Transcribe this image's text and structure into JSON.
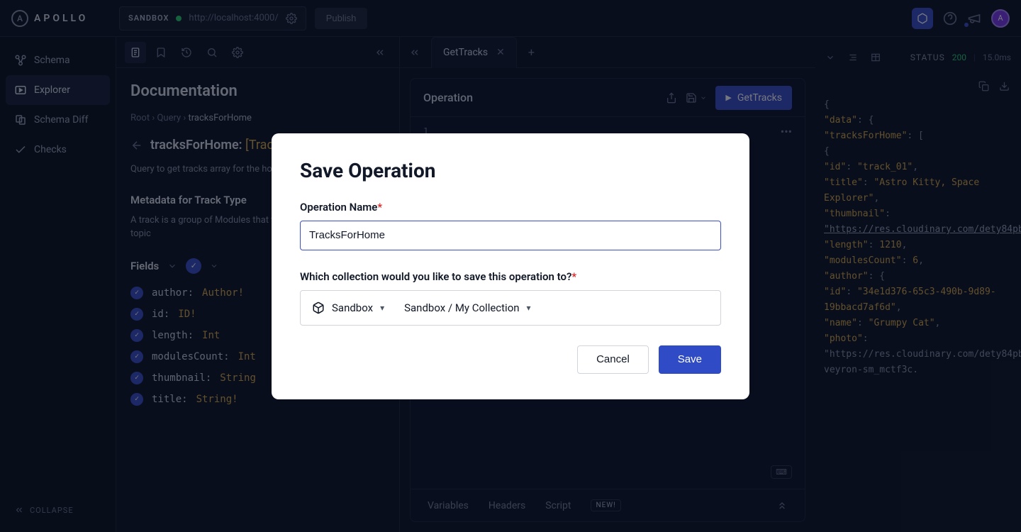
{
  "brand": "APOLLO",
  "topbar": {
    "sandbox_label": "SANDBOX",
    "url": "http://localhost:4000/",
    "publish": "Publish"
  },
  "nav": {
    "items": [
      {
        "label": "Schema"
      },
      {
        "label": "Explorer"
      },
      {
        "label": "Schema Diff"
      },
      {
        "label": "Checks"
      }
    ],
    "collapse": "COLLAPSE"
  },
  "doc": {
    "heading": "Documentation",
    "breadcrumb": {
      "root": "Root",
      "query": "Query",
      "current": "tracksForHome"
    },
    "field_name": "tracksForHome:",
    "field_type": "[Track!]!",
    "field_desc": "Query to get tracks array for the homepage grid",
    "meta_heading": "Metadata for Track Type",
    "meta_desc": "A track is a group of Modules that teaches about a specific topic",
    "fields_heading": "Fields",
    "fields": [
      {
        "name": "author:",
        "type": "Author!"
      },
      {
        "name": "id:",
        "type": "ID!"
      },
      {
        "name": "length:",
        "type": "Int"
      },
      {
        "name": "modulesCount:",
        "type": "Int"
      },
      {
        "name": "thumbnail:",
        "type": "String"
      },
      {
        "name": "title:",
        "type": "String!"
      }
    ]
  },
  "operation": {
    "tab": "GetTracks",
    "panel_title": "Operation",
    "run_label": "GetTracks",
    "footer": {
      "variables": "Variables",
      "headers": "Headers",
      "script": "Script",
      "new_badge": "NEW!"
    }
  },
  "response": {
    "status_label": "STATUS",
    "status_code": "200",
    "time": "15.0ms",
    "json_text": "{\n  \"data\": {\n    \"tracksForHome\": [\n      {\n        \"id\": \"track_01\",\n        \"title\": \"Astro Kitty, Space Explorer\",\n        \"thumbnail\": \"https://res.cloudinary.com/dety84pbu/image/upload/v1598465568/nebula_cat_djkt9r.jpg\",\n        \"length\": 1210,\n        \"modulesCount\": 6,\n        \"author\": {\n          \"id\": \"34e1d376-65c3-490b-9d89-19bbacd7af6d\",\n          \"name\": \"Grumpy Cat\",\n          \"photo\": \"https://res.cloudinary.com/dety84pbu/image/upload/v1606816219/kitty-veyron-sm_mctf3c."
  },
  "modal": {
    "title": "Save Operation",
    "name_label": "Operation Name",
    "name_value": "TracksForHome",
    "collection_label": "Which collection would you like to save this operation to?",
    "graph": "Sandbox",
    "collection": "Sandbox / My Collection",
    "cancel": "Cancel",
    "save": "Save"
  }
}
